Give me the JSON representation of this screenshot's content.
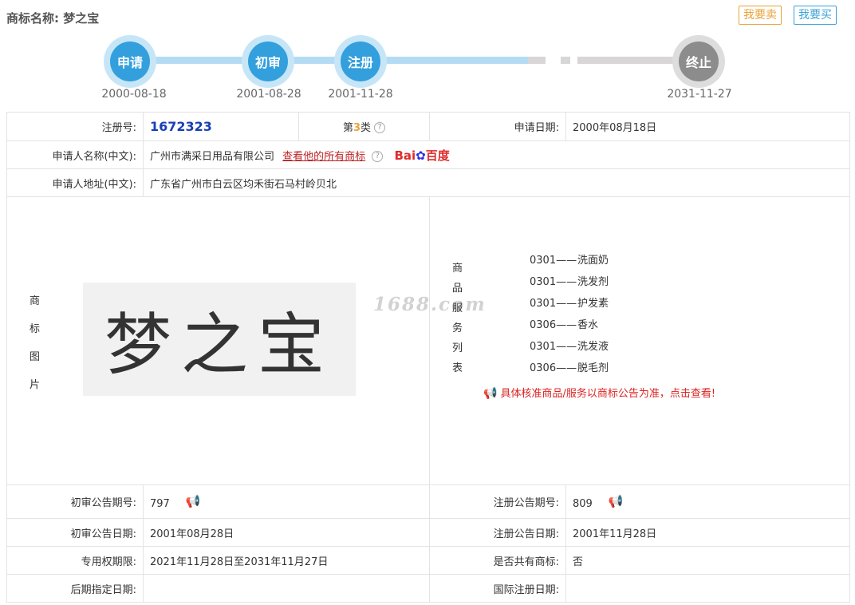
{
  "header": {
    "title_label": "商标名称:",
    "title_value": "梦之宝",
    "sell_label": "我要卖",
    "buy_label": "我要买"
  },
  "timeline": {
    "steps": [
      {
        "label": "申请",
        "date": "2000-08-18"
      },
      {
        "label": "初审",
        "date": "2001-08-28"
      },
      {
        "label": "注册",
        "date": "2001-11-28"
      },
      {
        "label": "终止",
        "date": "2031-11-27"
      }
    ]
  },
  "info": {
    "reg_no_label": "注册号:",
    "reg_no": "1672323",
    "class_prefix": "第",
    "class_num": "3",
    "class_suffix": "类",
    "apply_date_label": "申请日期:",
    "apply_date": "2000年08月18日",
    "applicant_label": "申请人名称(中文):",
    "applicant": "广州市满采日用品有限公司",
    "all_marks_link": "查看他的所有商标",
    "baidu_text": "Bai",
    "baidu_text2": "百度",
    "address_label": "申请人地址(中文):",
    "address": "广东省广州市白云区均禾街石马村岭贝北",
    "image_label_chars": [
      "商",
      "标",
      "图",
      "片"
    ],
    "trademark_text": "梦之宝",
    "watermark": "1688.com",
    "goods_label_chars": [
      "商",
      "品",
      "服",
      "务",
      "列",
      "表"
    ],
    "goods": [
      {
        "code": "0301——",
        "name": "洗面奶"
      },
      {
        "code": "0301——",
        "name": "洗发剂"
      },
      {
        "code": "0301——",
        "name": "护发素"
      },
      {
        "code": "0306——",
        "name": "香水"
      },
      {
        "code": "0301——",
        "name": "洗发液"
      },
      {
        "code": "0306——",
        "name": "脱毛剂"
      }
    ],
    "goods_notice": "具体核准商品/服务以商标公告为准，点击查看!",
    "prelim_no_label": "初审公告期号:",
    "prelim_no": "797",
    "reg_pub_no_label": "注册公告期号:",
    "reg_pub_no": "809",
    "prelim_date_label": "初审公告日期:",
    "prelim_date": "2001年08月28日",
    "reg_pub_date_label": "注册公告日期:",
    "reg_pub_date": "2001年11月28日",
    "exclusive_label": "专用权期限:",
    "exclusive": "2021年11月28日至2031年11月27日",
    "shared_label": "是否共有商标:",
    "shared": "否",
    "later_date_label": "后期指定日期:",
    "later_date": "",
    "intl_date_label": "国际注册日期:",
    "intl_date": ""
  }
}
